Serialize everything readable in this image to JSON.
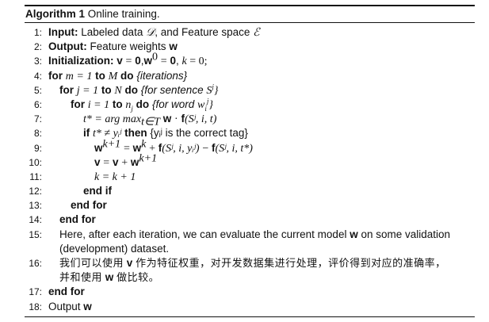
{
  "caption": {
    "label": "Algorithm 1",
    "title": "Online training."
  },
  "nums": [
    "1:",
    "2:",
    "3:",
    "4:",
    "5:",
    "6:",
    "7:",
    "8:",
    "9:",
    "10:",
    "11:",
    "12:",
    "13:",
    "14:",
    "15:",
    "",
    "16:",
    "",
    "17:",
    "18:"
  ],
  "l1": {
    "kw": "Input:",
    "a": "Labeled data",
    "b": ", and Feature space"
  },
  "l2": {
    "kw": "Output:",
    "a": "Feature weights",
    "w": "w"
  },
  "l3": {
    "kw": "Initialization:",
    "v": "v",
    "z1": "0",
    "w": "w",
    "z2": "0",
    "k": "k",
    "rest": " = 0;"
  },
  "l4": {
    "for": "for",
    "a": "m = 1",
    "to": "to",
    "b": "M",
    "do": "do",
    "c": "{iterations}"
  },
  "l5": {
    "for": "for",
    "a": "j = 1",
    "to": "to",
    "b": "N",
    "do": "do",
    "c": "{for sentence"
  },
  "l6": {
    "for": "for",
    "a": "i = 1",
    "to": "to",
    "b": "n",
    "do": "do",
    "c": "{for word"
  },
  "l7": {
    "a": "t* = arg max",
    "sub": "t∈T",
    "w": "w",
    "f": "f",
    "args": "(Sʲ, i, t)"
  },
  "l8": {
    "if": "if",
    "a": "t* ≠ yᵢʲ",
    "then": "then",
    "c": "{yᵢʲ is the correct tag}"
  },
  "l9": {
    "w": "w",
    "kp": "k+1",
    "f1": "f",
    "args1": "(Sʲ, i, yᵢʲ)",
    "f2": "f",
    "args2": "(Sʲ, i, t*)"
  },
  "l10": {
    "v": "v",
    "w": "w",
    "kp": "k+1"
  },
  "l11": {
    "a": "k = k + 1"
  },
  "l12": {
    "a": "end if"
  },
  "l13": {
    "a": "end for"
  },
  "l14": {
    "a": "end for"
  },
  "l15": {
    "a": "Here, after each iteration, we can evaluate the current model",
    "w": "w",
    "b": "on some validation",
    "c": "(development) dataset."
  },
  "l16": {
    "a": "我们可以使用",
    "v": "v",
    "b": "作为特征权重，对开发数据集进行处理，评价得到对应的准确率，",
    "c": "并和使用",
    "w": "w",
    "d": "做比较。"
  },
  "l17": {
    "a": "end for"
  },
  "l18": {
    "a": "Output",
    "w": "w"
  }
}
